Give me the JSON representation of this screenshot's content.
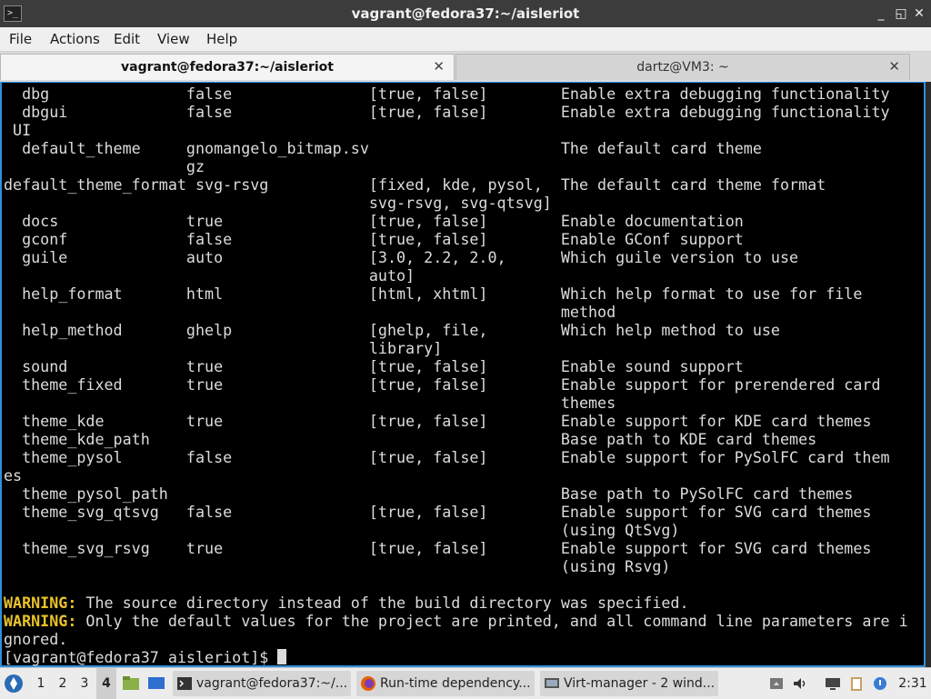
{
  "window": {
    "title": "vagrant@fedora37:~/aisleriot",
    "app_icon_glyph": ">_",
    "minimize_glyph": "_",
    "restore_glyph": "◱",
    "close_glyph": "✕"
  },
  "menu": {
    "file": "File",
    "actions": "Actions",
    "edit": "Edit",
    "view": "View",
    "help": "Help"
  },
  "tabs": [
    {
      "label": "vagrant@fedora37:~/aisleriot",
      "close": "✕",
      "active": true
    },
    {
      "label": "dartz@VM3: ~",
      "close": "✕",
      "active": false
    }
  ],
  "terminal": {
    "lines": [
      "  dbg               false               [true, false]        Enable extra debugging functionality",
      "  dbgui             false               [true, false]        Enable extra debugging functionality",
      " UI",
      "  default_theme     gnomangelo_bitmap.sv                     The default card theme",
      "                    gz",
      "default_theme_format svg-rsvg           [fixed, kde, pysol,  The default card theme format",
      "                                        svg-rsvg, svg-qtsvg]",
      "  docs              true                [true, false]        Enable documentation",
      "  gconf             false               [true, false]        Enable GConf support",
      "  guile             auto                [3.0, 2.2, 2.0,      Which guile version to use",
      "                                        auto]",
      "  help_format       html                [html, xhtml]        Which help format to use for file",
      "                                                             method",
      "  help_method       ghelp               [ghelp, file,        Which help method to use",
      "                                        library]",
      "  sound             true                [true, false]        Enable sound support",
      "  theme_fixed       true                [true, false]        Enable support for prerendered card",
      "                                                             themes",
      "  theme_kde         true                [true, false]        Enable support for KDE card themes",
      "  theme_kde_path                                             Base path to KDE card themes",
      "  theme_pysol       false               [true, false]        Enable support for PySolFC card them",
      "es",
      "  theme_pysol_path                                           Base path to PySolFC card themes",
      "  theme_svg_qtsvg   false               [true, false]        Enable support for SVG card themes",
      "                                                             (using QtSvg)",
      "  theme_svg_rsvg    true                [true, false]        Enable support for SVG card themes",
      "                                                             (using Rsvg)",
      ""
    ],
    "warning_label": "WARNING:",
    "warning1": " The source directory instead of the build directory was specified.",
    "warning2": " Only the default values for the project are printed, and all command line parameters are i",
    "warning2_cont": "gnored.",
    "prompt": "[vagrant@fedora37 aisleriot]$ "
  },
  "taskbar": {
    "workspaces": [
      "1",
      "2",
      "3",
      "4"
    ],
    "active_workspace": "4",
    "tasks": [
      {
        "label": "vagrant@fedora37:~/...",
        "icon": "terminal-icon"
      },
      {
        "label": "Run-time dependency...",
        "icon": "firefox-icon"
      },
      {
        "label": "Virt-manager - 2 wind...",
        "icon": "virt-manager-icon"
      }
    ],
    "clock": "2:31"
  },
  "colors": {
    "terminal_bg": "#000000",
    "terminal_fg": "#dcdcdc",
    "warning": "#e8c229",
    "focus_border": "#2f8fdc"
  }
}
